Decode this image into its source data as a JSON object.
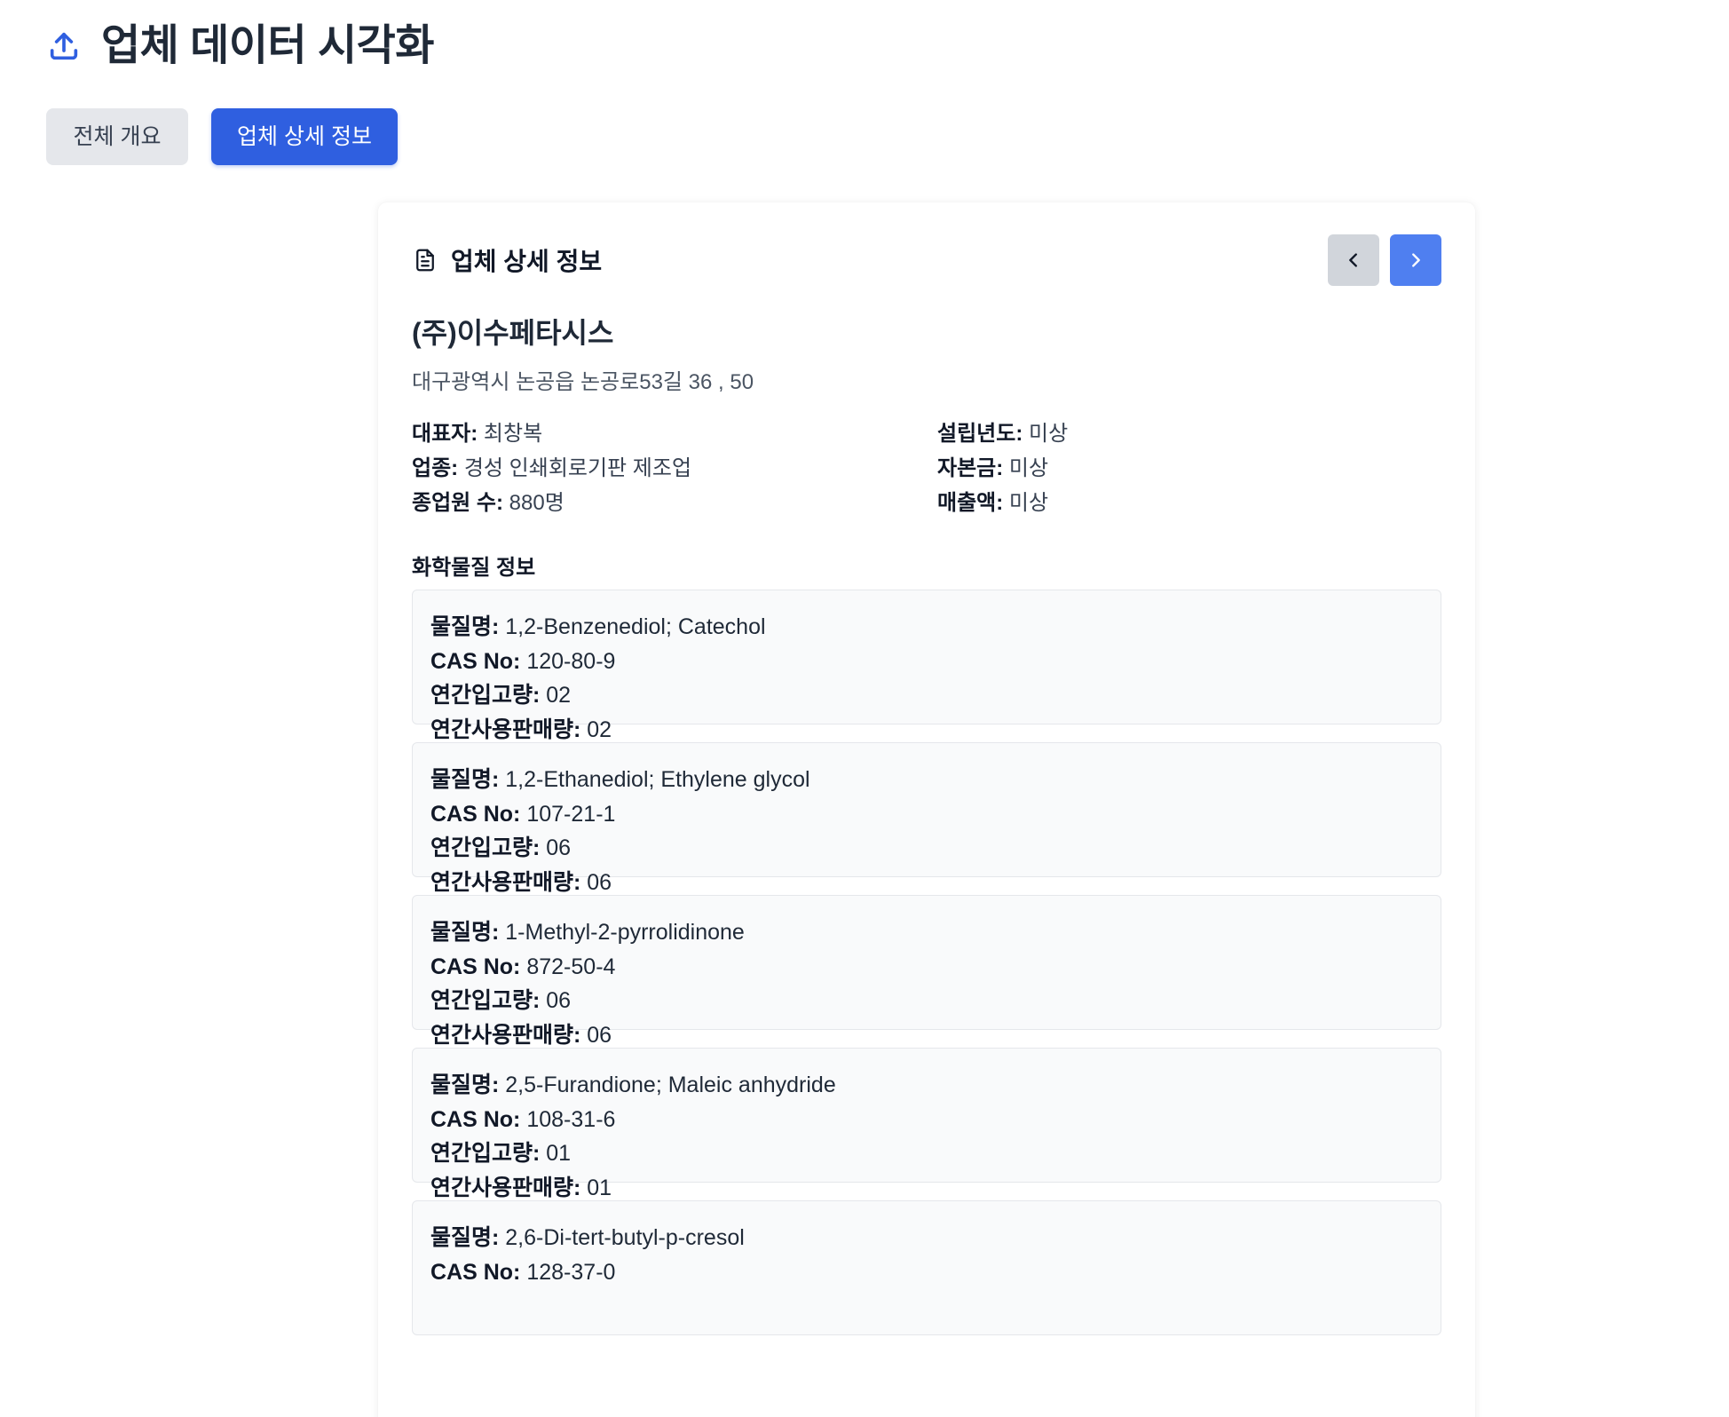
{
  "header": {
    "title": "업체 데이터 시각화",
    "icon": "upload-icon"
  },
  "tabs": {
    "overview_label": "전체 개요",
    "detail_label": "업체 상세 정보"
  },
  "card": {
    "title": "업체 상세 정보",
    "icon": "document-icon",
    "prev_icon": "chevron-left-icon",
    "next_icon": "chevron-right-icon"
  },
  "company": {
    "name": "(주)이수페타시스",
    "address": "대구광역시 논공읍 논공로53길 36 , 50",
    "representative_label": "대표자:",
    "representative": "최창복",
    "industry_label": "업종:",
    "industry": "경성 인쇄회로기판 제조업",
    "employees_label": "종업원 수:",
    "employees": "880명",
    "founded_label": "설립년도:",
    "founded": "미상",
    "capital_label": "자본금:",
    "capital": "미상",
    "revenue_label": "매출액:",
    "revenue": "미상"
  },
  "chemicals": {
    "section_title": "화학물질 정보",
    "name_label": "물질명:",
    "cas_label": "CAS No:",
    "import_label": "연간입고량:",
    "usage_label": "연간사용판매량:",
    "items": [
      {
        "name": "1,2-Benzenediol; Catechol",
        "cas": "120-80-9",
        "import": "02",
        "usage": "02"
      },
      {
        "name": "1,2-Ethanediol; Ethylene glycol",
        "cas": "107-21-1",
        "import": "06",
        "usage": "06"
      },
      {
        "name": "1-Methyl-2-pyrrolidinone",
        "cas": "872-50-4",
        "import": "06",
        "usage": "06"
      },
      {
        "name": "2,5-Furandione; Maleic anhydride",
        "cas": "108-31-6",
        "import": "01",
        "usage": "01"
      },
      {
        "name": "2,6-Di-tert-butyl-p-cresol",
        "cas": "128-37-0",
        "import": "",
        "usage": ""
      }
    ]
  },
  "colors": {
    "primary": "#2f5fe0",
    "next_button": "#4f7ff0",
    "prev_button": "#d1d5db",
    "inactive_tab": "#e5e7eb"
  }
}
